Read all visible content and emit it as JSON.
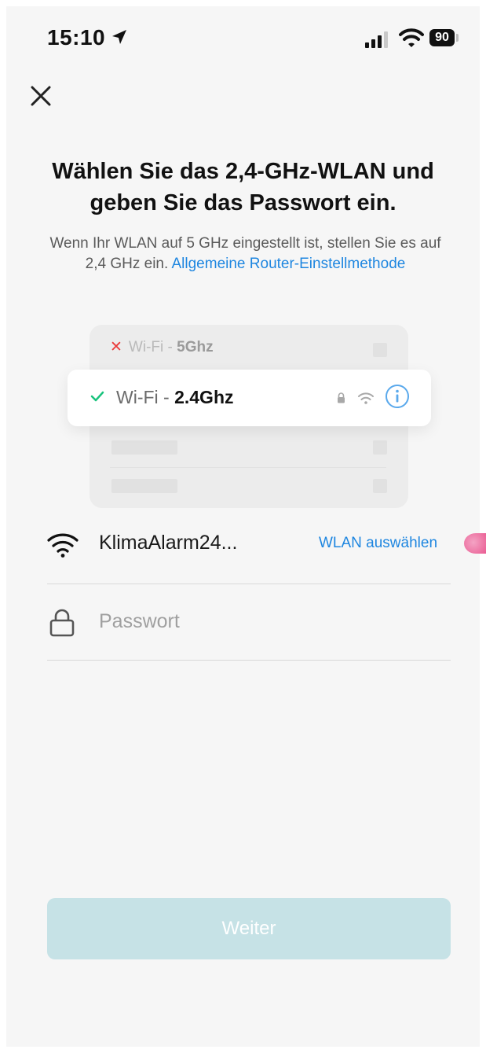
{
  "status_bar": {
    "time": "15:10",
    "battery": "90"
  },
  "heading": {
    "title": "Wählen Sie das 2,4-GHz-WLAN und geben Sie das Passwort ein.",
    "subtitle": "Wenn Ihr WLAN auf 5 GHz eingestellt ist, stellen Sie es auf 2,4 GHz ein.",
    "link": "Allgemeine Router-Einstellmethode"
  },
  "illustration": {
    "row_5ghz": {
      "mark": "✕",
      "prefix": "Wi-Fi - ",
      "band": "5Ghz"
    },
    "row_24ghz": {
      "prefix": "Wi-Fi - ",
      "band": "2.4Ghz"
    }
  },
  "form": {
    "ssid": "KlimaAlarm24...",
    "select_wlan": "WLAN auswählen",
    "password_placeholder": "Passwort",
    "password_value": ""
  },
  "next_button": "Weiter",
  "colors": {
    "accent": "#1e86e0",
    "button_disabled": "#c6e2e6",
    "check_green": "#19c37d",
    "error_red": "#ea3b3b"
  }
}
